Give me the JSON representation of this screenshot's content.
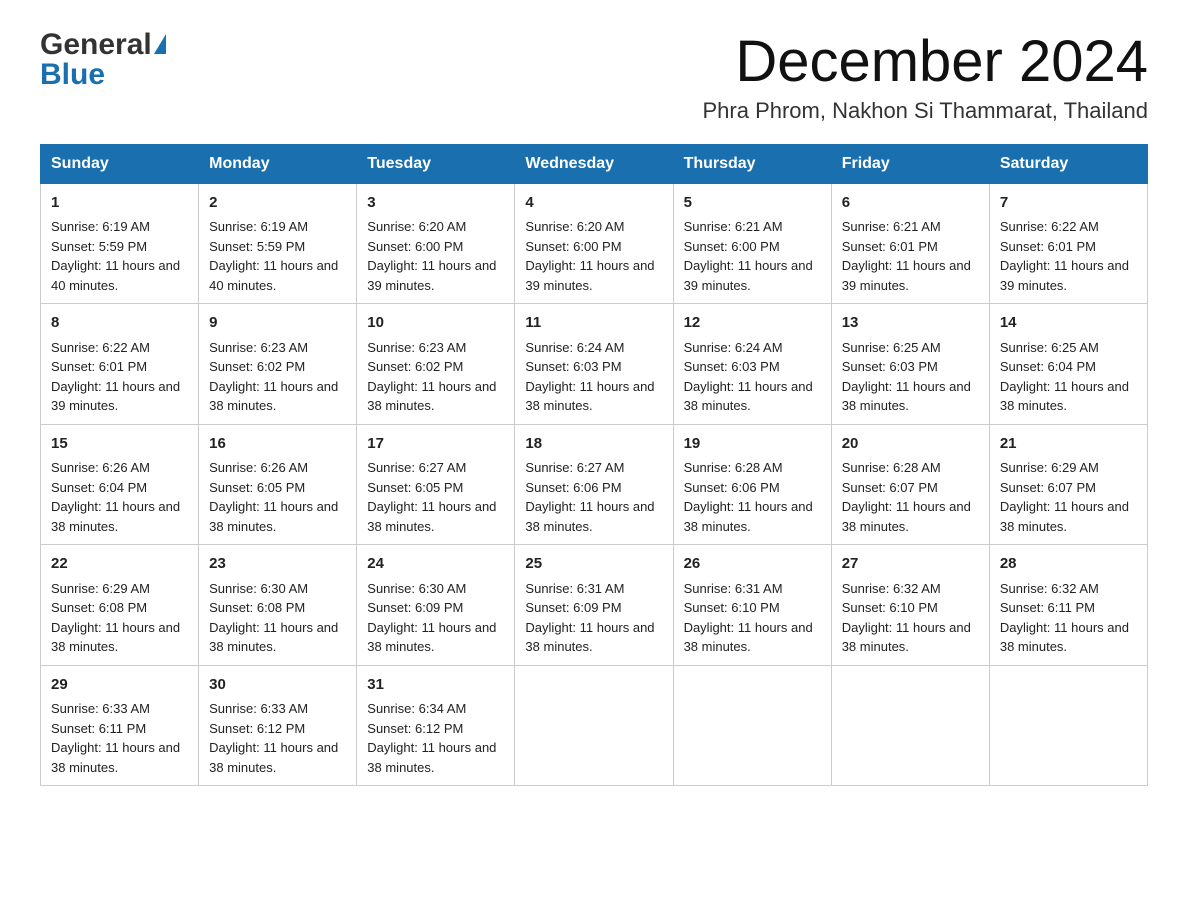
{
  "header": {
    "logo_general": "General",
    "logo_blue": "Blue",
    "month_title": "December 2024",
    "location": "Phra Phrom, Nakhon Si Thammarat, Thailand"
  },
  "days_of_week": [
    "Sunday",
    "Monday",
    "Tuesday",
    "Wednesday",
    "Thursday",
    "Friday",
    "Saturday"
  ],
  "weeks": [
    [
      {
        "day": "1",
        "sunrise": "6:19 AM",
        "sunset": "5:59 PM",
        "daylight": "11 hours and 40 minutes."
      },
      {
        "day": "2",
        "sunrise": "6:19 AM",
        "sunset": "5:59 PM",
        "daylight": "11 hours and 40 minutes."
      },
      {
        "day": "3",
        "sunrise": "6:20 AM",
        "sunset": "6:00 PM",
        "daylight": "11 hours and 39 minutes."
      },
      {
        "day": "4",
        "sunrise": "6:20 AM",
        "sunset": "6:00 PM",
        "daylight": "11 hours and 39 minutes."
      },
      {
        "day": "5",
        "sunrise": "6:21 AM",
        "sunset": "6:00 PM",
        "daylight": "11 hours and 39 minutes."
      },
      {
        "day": "6",
        "sunrise": "6:21 AM",
        "sunset": "6:01 PM",
        "daylight": "11 hours and 39 minutes."
      },
      {
        "day": "7",
        "sunrise": "6:22 AM",
        "sunset": "6:01 PM",
        "daylight": "11 hours and 39 minutes."
      }
    ],
    [
      {
        "day": "8",
        "sunrise": "6:22 AM",
        "sunset": "6:01 PM",
        "daylight": "11 hours and 39 minutes."
      },
      {
        "day": "9",
        "sunrise": "6:23 AM",
        "sunset": "6:02 PM",
        "daylight": "11 hours and 38 minutes."
      },
      {
        "day": "10",
        "sunrise": "6:23 AM",
        "sunset": "6:02 PM",
        "daylight": "11 hours and 38 minutes."
      },
      {
        "day": "11",
        "sunrise": "6:24 AM",
        "sunset": "6:03 PM",
        "daylight": "11 hours and 38 minutes."
      },
      {
        "day": "12",
        "sunrise": "6:24 AM",
        "sunset": "6:03 PM",
        "daylight": "11 hours and 38 minutes."
      },
      {
        "day": "13",
        "sunrise": "6:25 AM",
        "sunset": "6:03 PM",
        "daylight": "11 hours and 38 minutes."
      },
      {
        "day": "14",
        "sunrise": "6:25 AM",
        "sunset": "6:04 PM",
        "daylight": "11 hours and 38 minutes."
      }
    ],
    [
      {
        "day": "15",
        "sunrise": "6:26 AM",
        "sunset": "6:04 PM",
        "daylight": "11 hours and 38 minutes."
      },
      {
        "day": "16",
        "sunrise": "6:26 AM",
        "sunset": "6:05 PM",
        "daylight": "11 hours and 38 minutes."
      },
      {
        "day": "17",
        "sunrise": "6:27 AM",
        "sunset": "6:05 PM",
        "daylight": "11 hours and 38 minutes."
      },
      {
        "day": "18",
        "sunrise": "6:27 AM",
        "sunset": "6:06 PM",
        "daylight": "11 hours and 38 minutes."
      },
      {
        "day": "19",
        "sunrise": "6:28 AM",
        "sunset": "6:06 PM",
        "daylight": "11 hours and 38 minutes."
      },
      {
        "day": "20",
        "sunrise": "6:28 AM",
        "sunset": "6:07 PM",
        "daylight": "11 hours and 38 minutes."
      },
      {
        "day": "21",
        "sunrise": "6:29 AM",
        "sunset": "6:07 PM",
        "daylight": "11 hours and 38 minutes."
      }
    ],
    [
      {
        "day": "22",
        "sunrise": "6:29 AM",
        "sunset": "6:08 PM",
        "daylight": "11 hours and 38 minutes."
      },
      {
        "day": "23",
        "sunrise": "6:30 AM",
        "sunset": "6:08 PM",
        "daylight": "11 hours and 38 minutes."
      },
      {
        "day": "24",
        "sunrise": "6:30 AM",
        "sunset": "6:09 PM",
        "daylight": "11 hours and 38 minutes."
      },
      {
        "day": "25",
        "sunrise": "6:31 AM",
        "sunset": "6:09 PM",
        "daylight": "11 hours and 38 minutes."
      },
      {
        "day": "26",
        "sunrise": "6:31 AM",
        "sunset": "6:10 PM",
        "daylight": "11 hours and 38 minutes."
      },
      {
        "day": "27",
        "sunrise": "6:32 AM",
        "sunset": "6:10 PM",
        "daylight": "11 hours and 38 minutes."
      },
      {
        "day": "28",
        "sunrise": "6:32 AM",
        "sunset": "6:11 PM",
        "daylight": "11 hours and 38 minutes."
      }
    ],
    [
      {
        "day": "29",
        "sunrise": "6:33 AM",
        "sunset": "6:11 PM",
        "daylight": "11 hours and 38 minutes."
      },
      {
        "day": "30",
        "sunrise": "6:33 AM",
        "sunset": "6:12 PM",
        "daylight": "11 hours and 38 minutes."
      },
      {
        "day": "31",
        "sunrise": "6:34 AM",
        "sunset": "6:12 PM",
        "daylight": "11 hours and 38 minutes."
      },
      null,
      null,
      null,
      null
    ]
  ],
  "labels": {
    "sunrise": "Sunrise:",
    "sunset": "Sunset:",
    "daylight": "Daylight:"
  }
}
